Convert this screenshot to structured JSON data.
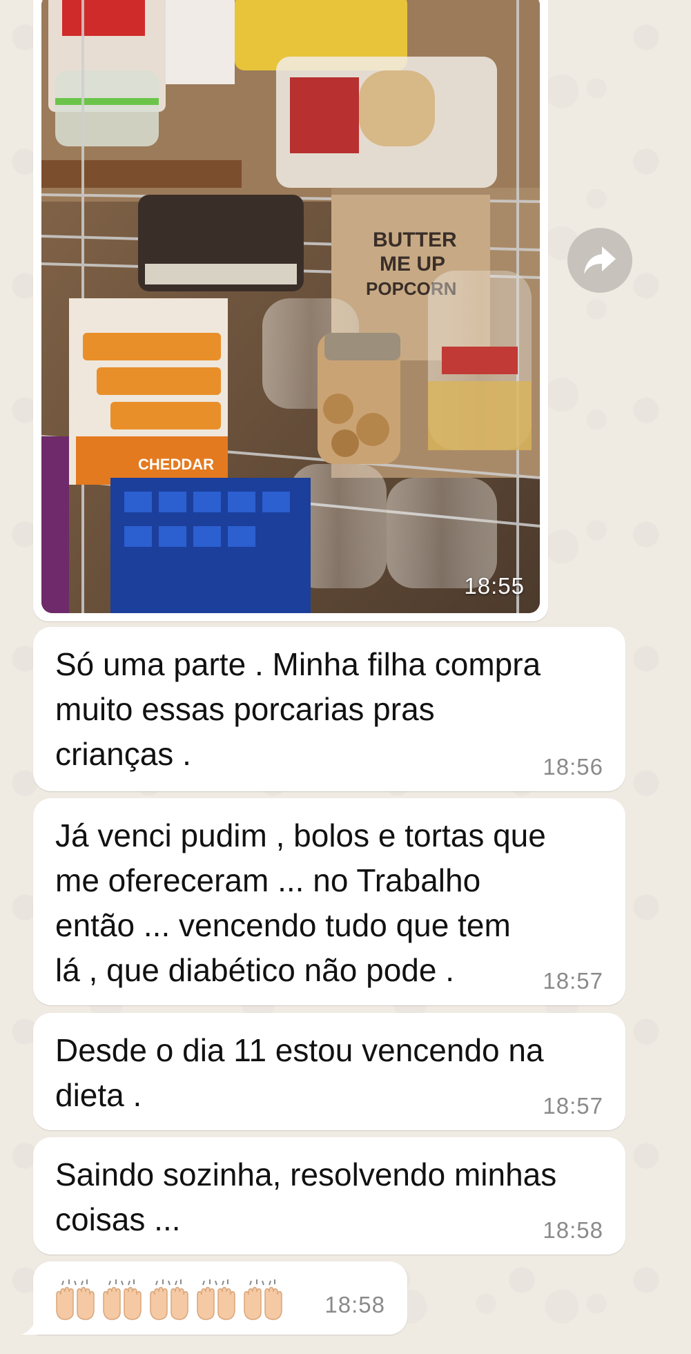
{
  "chat": {
    "image_message": {
      "time": "18:55",
      "forward_icon": "share-arrow-icon"
    },
    "messages": [
      {
        "text": "Só uma parte . Minha filha compra\nmuito essas porcarias pras\ncrianças .",
        "time": "18:56"
      },
      {
        "text": "Já venci pudim , bolos e tortas que\nme ofereceram ... no Trabalho\nentão ... vencendo tudo que tem\nlá , que diabético não pode .",
        "time": "18:57"
      },
      {
        "text": "Desde o dia 11 estou vencendo na\ndieta .",
        "time": "18:57"
      },
      {
        "text": "Saindo sozinha, resolvendo minhas\ncoisas ...",
        "time": "18:58"
      }
    ],
    "emoji_message": {
      "emoji_icon": "raising-hands-icon",
      "count": 5,
      "time": "18:58"
    }
  },
  "colors": {
    "bubble": "#ffffff",
    "wallpaper": "#efeae2",
    "timestamp": "#8a8a8a"
  }
}
